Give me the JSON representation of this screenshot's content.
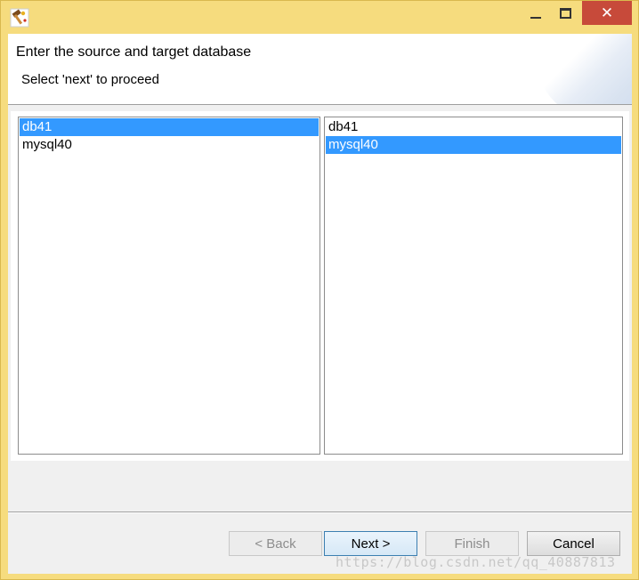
{
  "window": {
    "icon": "hammer-wizard-icon",
    "controls": {
      "minimize": "minimize-icon",
      "maximize": "maximize-icon",
      "close": "✕"
    },
    "frame_color": "#f6dc7e",
    "close_color": "#c74a3a"
  },
  "banner": {
    "title": "Enter the source and target database",
    "subtitle": "Select 'next' to proceed"
  },
  "source_list": {
    "items": [
      {
        "label": "db41",
        "selected": true
      },
      {
        "label": "mysql40",
        "selected": false
      }
    ]
  },
  "target_list": {
    "items": [
      {
        "label": "db41",
        "selected": false
      },
      {
        "label": "mysql40",
        "selected": true
      }
    ]
  },
  "buttons": {
    "back": "< Back",
    "next": "Next >",
    "finish": "Finish",
    "cancel": "Cancel"
  },
  "selection_color": "#3399ff",
  "watermark": "https://blog.csdn.net/qq_40887813"
}
